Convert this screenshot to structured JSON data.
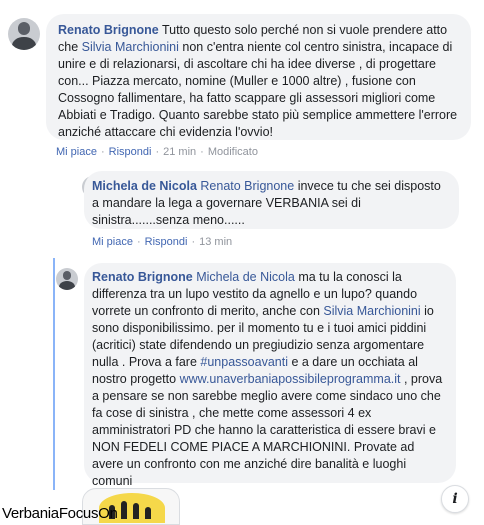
{
  "comments": [
    {
      "author": "Renato Brignone",
      "text_before": " Tutto questo solo perché non si vuole prendere atto che ",
      "mention": "Silvia Marchionini",
      "text_after": " non c'entra niente col centro sinistra, incapace di unire e di relazionarsi, di ascoltare chi ha idee diverse , di progettare con... Piazza mercato, nomine (Muller e 1000 altre) , fusione con Cossogno fallimentare, ha fatto scappare gli assessori migliori come Abbiati e Tradigo. Quanto sarebbe stato più semplice ammettere l'errore anziché attaccare chi evidenzia l'ovvio!",
      "actions": {
        "like": "Mi piace",
        "reply": "Rispondi",
        "time": "21 min",
        "edited": "Modificato"
      }
    },
    {
      "author": "Michela de Nicola",
      "mention": "Renato Brignone",
      "text": " invece tu che sei disposto a mandare la lega a governare VERBANIA sei di sinistra.......senza meno......",
      "actions": {
        "like": "Mi piace",
        "reply": "Rispondi",
        "time": "13 min"
      }
    },
    {
      "author": "Renato Brignone",
      "mention1": "Michela de Nicola",
      "text1": " ma tu la conosci la differenza tra un lupo vestito da agnello e un lupo? quando vorrete un confronto di merito, anche con ",
      "mention2": "Silvia Marchionini",
      "text2": " io sono disponibilissimo. per il momento tu e i tuoi amici piddini (acritici) state difendendo un pregiudizio senza argomentare nulla . Prova a fare ",
      "hashtag": "#unpassoavanti",
      "text3": " e a dare un occhiata al nostro progetto ",
      "link": "www.unaverbaniapossibileprogramma.it",
      "text4": " , prova a pensare se non sarebbe meglio avere come sindaco uno che fa cose di sinistra , che mette come assessori 4 ex amministratori PD che hanno la caratteristica di essere bravi e NON FEDELI COME PIACE A MARCHIONINI. Provate ad avere un confronto con me anziché dire banalità e luoghi comuni"
    }
  ],
  "info_button": "i",
  "watermark": "VerbaniaFocusOn",
  "colors": {
    "link": "#385898",
    "bubble": "#f2f3f5",
    "meta": "#90949c",
    "thread": "#8ab4f8"
  }
}
